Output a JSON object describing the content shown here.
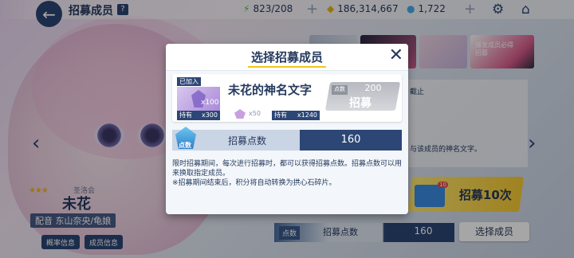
{
  "header": {
    "back_icon": "arrow-left-icon",
    "title": "招募成员",
    "help_label": "?",
    "energy": "823/208",
    "credits": "186,314,667",
    "gems": "1,722",
    "plus": "+"
  },
  "character": {
    "stars": "★★★",
    "school": "圣洛会",
    "name": "未花",
    "cv": "配音 东山奈央/龟娘",
    "btn_profile": "概率信息",
    "btn_member": "成员信息"
  },
  "background": {
    "banner_text": "爆发成员必得招募",
    "notice_end": "截止",
    "notice_text": "与该成员的神名文字。",
    "recruit10": "招募10次",
    "mail_count": "10"
  },
  "bottom": {
    "point_icon_label": "点数",
    "label": "招募点数",
    "value": "160",
    "select_button": "选择成员"
  },
  "modal": {
    "title": "选择招募成员",
    "close": "✕",
    "card": {
      "added_label": "已加入",
      "portrait_count": "x100",
      "hold_label": "持有",
      "hold_count": "x300",
      "item_count": "x50",
      "hold_label2": "持有",
      "hold_count2": "x1240",
      "name": "未花的神名文字",
      "cost_label": "点数",
      "cost": "200",
      "recruit_label": "招募"
    },
    "points": {
      "gem_label": "点数",
      "label": "招募点数",
      "value": "160"
    },
    "note1": "限时招募期间，每次进行招募时，都可以获得招募点数。招募点数可以用来换取指定成员。",
    "note2": "※招募期间结束后，积分将自动转换为拱心石碎片。"
  }
}
